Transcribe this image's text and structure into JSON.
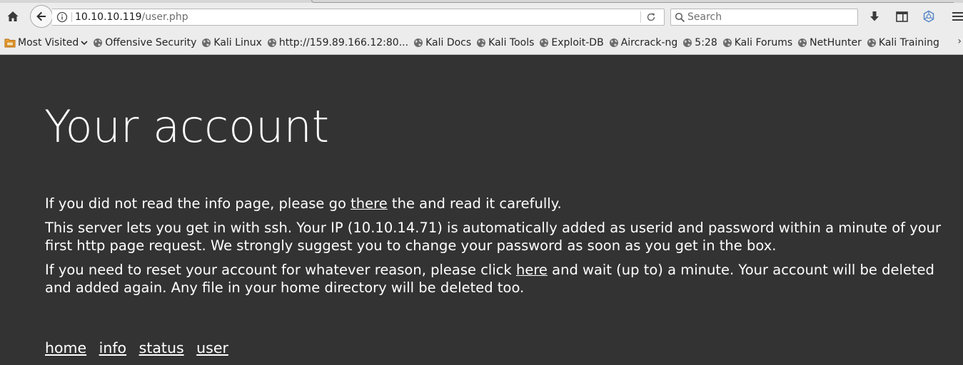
{
  "browser": {
    "url_host": "10.10.10.119",
    "url_path": "/user.php",
    "search_placeholder": "Search",
    "bookmarks": [
      {
        "label": "Most Visited",
        "icon": "folder-icon"
      },
      {
        "label": "Offensive Security",
        "icon": "globe-icon"
      },
      {
        "label": "Kali Linux",
        "icon": "globe-icon"
      },
      {
        "label": "http://159.89.166.12:80...",
        "icon": "globe-icon"
      },
      {
        "label": "Kali Docs",
        "icon": "globe-icon"
      },
      {
        "label": "Kali Tools",
        "icon": "globe-icon"
      },
      {
        "label": "Exploit-DB",
        "icon": "globe-icon"
      },
      {
        "label": "Aircrack-ng",
        "icon": "globe-icon"
      },
      {
        "label": "5:28",
        "icon": "globe-icon"
      },
      {
        "label": "Kali Forums",
        "icon": "globe-icon"
      },
      {
        "label": "NetHunter",
        "icon": "globe-icon"
      },
      {
        "label": "Kali Training",
        "icon": "globe-icon"
      }
    ],
    "bookmarks_overflow": "›",
    "icons": [
      "home-icon",
      "back-arrow-icon",
      "info-icon",
      "reload-icon",
      "search-icon",
      "download-icon",
      "sidebar-icon",
      "extension-icon",
      "hamburger-menu-icon"
    ]
  },
  "page": {
    "title": "Your account",
    "para1": {
      "before": "If you did not read the info page, please go ",
      "link": "there",
      "after": " the and read it carefully."
    },
    "para2": "This server lets you get in with ssh. Your IP (10.10.14.71) is automatically added as userid and password within a minute of your first http page request. We strongly suggest you to change your password as soon as you get in the box.",
    "para3": {
      "before": "If you need to reset your account for whatever reason, please click ",
      "link": "here",
      "after": " and wait (up to) a minute. Your account will be deleted and added again. Any file in your home directory will be deleted too."
    },
    "nav": [
      "home",
      "info",
      "status",
      "user"
    ]
  },
  "colors": {
    "page_background": "#333333",
    "page_text": "#ffffff",
    "chrome_background": "#ececec"
  }
}
